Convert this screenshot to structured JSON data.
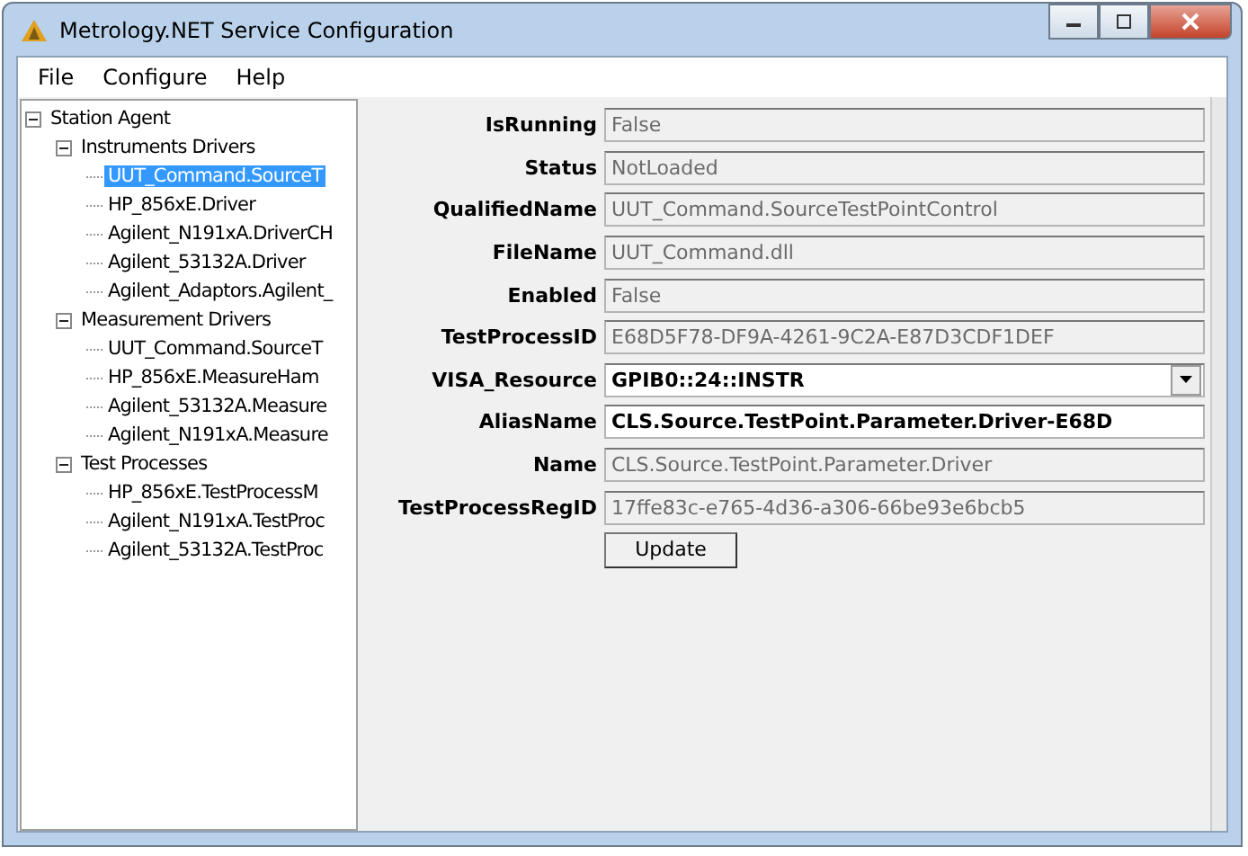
{
  "window": {
    "title": "Metrology.NET Service Configuration"
  },
  "menu": [
    "File",
    "Configure",
    "Help"
  ],
  "tree": [
    {
      "label": "Station Agent",
      "expanded": true,
      "selected": false,
      "children": [
        {
          "label": "Instruments Drivers",
          "expanded": true,
          "selected": false,
          "children": [
            {
              "label": "UUT_Command.SourceT",
              "selected": true
            },
            {
              "label": "HP_856xE.Driver",
              "selected": false
            },
            {
              "label": "Agilent_N191xA.DriverCH",
              "selected": false
            },
            {
              "label": "Agilent_53132A.Driver",
              "selected": false
            },
            {
              "label": "Agilent_Adaptors.Agilent_",
              "selected": false
            }
          ]
        },
        {
          "label": "Measurement Drivers",
          "expanded": true,
          "selected": false,
          "children": [
            {
              "label": "UUT_Command.SourceT",
              "selected": false
            },
            {
              "label": "HP_856xE.MeasureHam",
              "selected": false
            },
            {
              "label": "Agilent_53132A.Measure",
              "selected": false
            },
            {
              "label": "Agilent_N191xA.Measure",
              "selected": false
            }
          ]
        },
        {
          "label": "Test Processes",
          "expanded": true,
          "selected": false,
          "children": [
            {
              "label": "HP_856xE.TestProcessM",
              "selected": false
            },
            {
              "label": "Agilent_N191xA.TestProc",
              "selected": false
            },
            {
              "label": "Agilent_53132A.TestProc",
              "selected": false
            }
          ]
        }
      ]
    }
  ],
  "properties": [
    {
      "label": "IsRunning",
      "value": "False",
      "kind": "text",
      "disabled": true
    },
    {
      "label": "Status",
      "value": "NotLoaded",
      "kind": "text",
      "disabled": true
    },
    {
      "label": "QualifiedName",
      "value": "UUT_Command.SourceTestPointControl",
      "kind": "text",
      "disabled": true
    },
    {
      "label": "FileName",
      "value": "UUT_Command.dll",
      "kind": "text",
      "disabled": true
    },
    {
      "label": "Enabled",
      "value": "False",
      "kind": "text",
      "disabled": true
    },
    {
      "label": "TestProcessID",
      "value": "E68D5F78-DF9A-4261-9C2A-E87D3CDF1DEF",
      "kind": "text",
      "disabled": true
    },
    {
      "label": "VISA_Resource",
      "value": "GPIB0::24::INSTR",
      "kind": "dropdown",
      "disabled": false
    },
    {
      "label": "AliasName",
      "value": "CLS.Source.TestPoint.Parameter.Driver-E68D",
      "kind": "text",
      "disabled": false
    },
    {
      "label": "Name",
      "value": "CLS.Source.TestPoint.Parameter.Driver",
      "kind": "text",
      "disabled": true
    },
    {
      "label": "TestProcessRegID",
      "value": "17ffe83c-e765-4d36-a306-66be93e6bcb5",
      "kind": "text",
      "disabled": true
    }
  ],
  "update_button": "Update"
}
